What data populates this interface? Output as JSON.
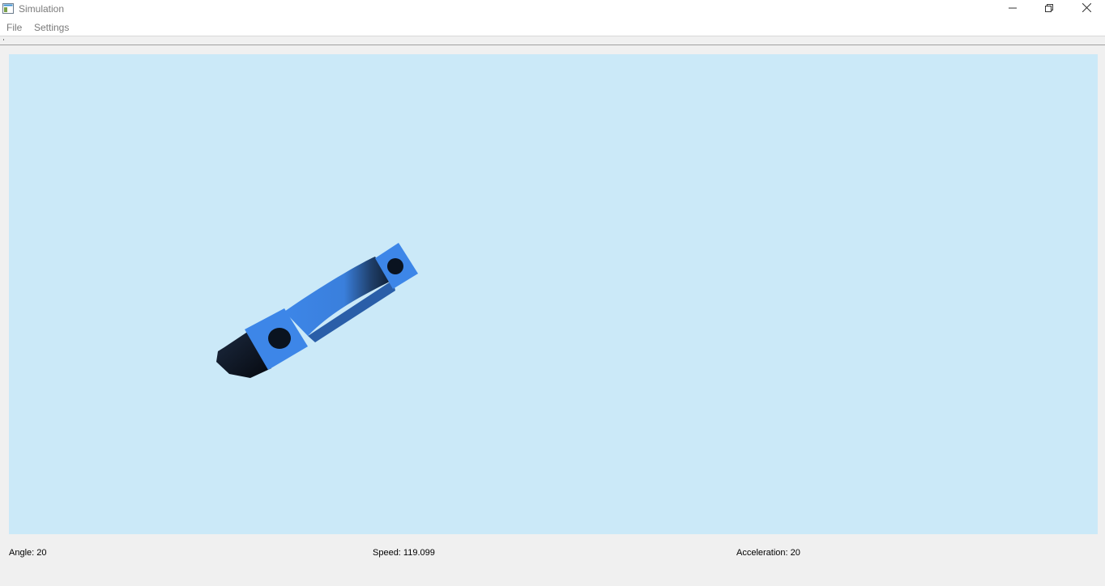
{
  "window": {
    "title": "Simulation"
  },
  "menu": {
    "file": "File",
    "settings": "Settings"
  },
  "icons": {
    "app": "window-icon",
    "minimize": "minimize-icon",
    "maximize": "restore-icon",
    "close": "close-icon"
  },
  "viewport": {
    "background": "#cbe9f8",
    "object_color": "#3d86e8",
    "object_shadow": "#0a1320"
  },
  "status": {
    "angle": "Angle: 20",
    "speed": "Speed: 119.099",
    "acceleration": "Acceleration: 20"
  }
}
